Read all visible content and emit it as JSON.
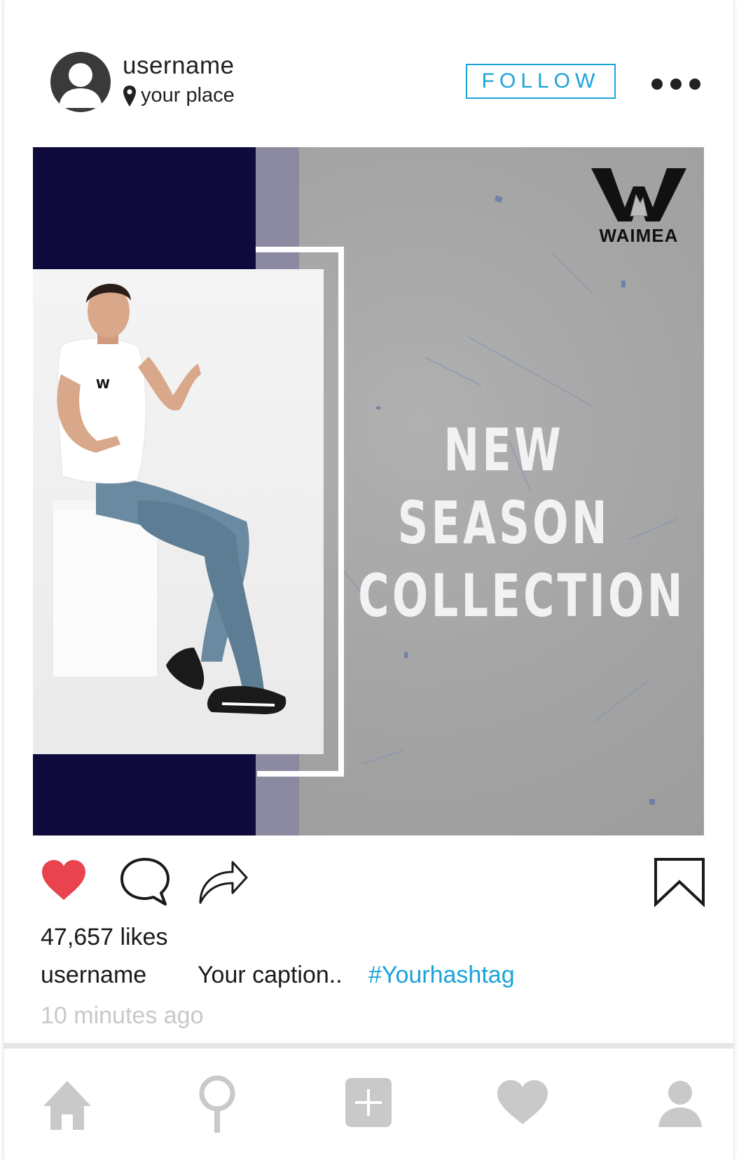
{
  "header": {
    "username": "username",
    "location": "your place",
    "follow_label": "FOLLOW"
  },
  "post": {
    "brand_name": "WAIMEA",
    "headline": [
      "NEW",
      "SEASON",
      "COLLECTION"
    ]
  },
  "engagement": {
    "likes_text": "47,657 likes",
    "caption_username": "username",
    "caption_text": "Your caption..",
    "caption_hashtag": "#Yourhashtag",
    "timestamp": "10 minutes ago",
    "liked": true
  },
  "colors": {
    "accent": "#1aa3d9",
    "like_red": "#e8434f",
    "navy": "#0e0a3c",
    "nav_gray": "#c9c9c9"
  },
  "icons": {
    "like": "heart-icon",
    "comment": "comment-bubble-icon",
    "share": "share-arrow-icon",
    "save": "bookmark-icon",
    "nav": [
      "home-icon",
      "search-icon",
      "add-post-icon",
      "activity-heart-icon",
      "profile-icon"
    ]
  }
}
